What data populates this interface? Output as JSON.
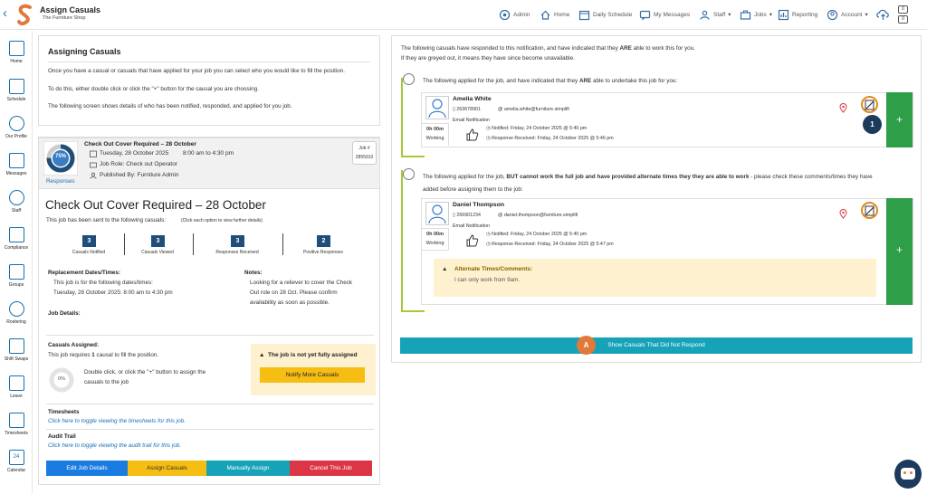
{
  "app": {
    "title": "Assign Casuals",
    "subtitle": "The Furniture Shop",
    "nav": [
      {
        "label": "Admin",
        "icon": "admin-icon"
      },
      {
        "label": "Home",
        "icon": "home-icon"
      },
      {
        "label": "Daily Schedule",
        "icon": "calendar-icon"
      },
      {
        "label": "My Messages",
        "icon": "messages-icon"
      },
      {
        "label": "Staff",
        "icon": "staff-icon"
      },
      {
        "label": "Jobs",
        "icon": "jobs-icon"
      },
      {
        "label": "Reporting",
        "icon": "reporting-icon"
      },
      {
        "label": "Account",
        "icon": "account-icon"
      }
    ],
    "badge_top": "0",
    "badge_bottom": "0"
  },
  "sidebar": {
    "items": [
      "Home",
      "Schedule",
      "Our Profile",
      "Messages",
      "Staff",
      "Compliance",
      "Groups",
      "Rostering",
      "Shift Swaps",
      "Leave",
      "Timesheets",
      "Calendar"
    ],
    "calendar_day": "24"
  },
  "intro": {
    "heading": "Assigning Casuals",
    "lines": [
      "Once you have a casual or casuals that have applied for your job you can select who you would like to fill the position.",
      "To do this, either double click or click the \"+\" button for the causal you are choosing.",
      "The following screen shows details of who has been notified, responded, and applied for you job."
    ]
  },
  "job": {
    "progress_label": "75%",
    "progress_value": 0.75,
    "responses_link": "Responses",
    "title": "Check Out Cover Required – 28 October",
    "date": "Tuesday, 28 October 2025",
    "time": "8:00 am to 4:30 pm",
    "role": "Job Role: Check out Operator",
    "published": "Published By: Furniture Admin",
    "job_number_label": "Job #",
    "job_number": "2855910",
    "big_title": "Check Out Cover Required – 28 October",
    "sent_to": "This job has been sent to the following casuals:",
    "sent_hint": "(Click each option to view further details)",
    "stats": [
      {
        "value": "3",
        "label": "Casuals Notified"
      },
      {
        "value": "3",
        "label": "Casuals Viewed"
      },
      {
        "value": "3",
        "label": "Responses Received"
      },
      {
        "value": "2",
        "label": "Positive Responses"
      }
    ],
    "replacement_heading": "Replacement Dates/Times:",
    "replacement_line1": "This job is for the following dates/times:",
    "replacement_line2": "Tuesday, 28 October 2025: 8:00 am to 4:30 pm",
    "notes_heading": "Notes:",
    "notes": [
      "Looking for a reliever to cover the Check",
      "Out role on 28 Oct. Please confirm",
      "availability as soon as possible."
    ],
    "job_details_heading": "Job Details:",
    "casuals_assigned_heading": "Casuals Assigned:",
    "requires_pre": "This job requires ",
    "requires_num": "1",
    "requires_post": " causal to fill the position.",
    "assigned_pct": "0%",
    "assign_hint": [
      "Double click, or click the \"+\" button to assign the",
      "casuals to the job"
    ],
    "warning": "The job is not yet fully assigned",
    "notify_more": "Notify More Casuals",
    "timesheets_heading": "Timesheets",
    "timesheets_link": "Click here to toggle viewing the timesheets for this job.",
    "audit_heading": "Audit Trail",
    "audit_link": "Click here to toggle viewing the audit trail for this job.",
    "buttons": {
      "edit": "Edit Job Details",
      "assign": "Assign Casuals",
      "manual": "Manually Assign",
      "cancel": "Cancel This Job"
    }
  },
  "responses": {
    "intro1_pre": "The following casuals have responded to this notification, and have indicated that they ",
    "intro1_bold": "ARE",
    "intro1_post": " able to work this for you.",
    "intro2": "If they are greyed out, it means they have since become unavailable.",
    "full_heading_pre": "The following applied for the job, and have indicated that they ",
    "full_heading_bold": "ARE",
    "full_heading_post": " able to undertake this job for you:",
    "partial_heading_pre": "The following applied for the job, ",
    "partial_heading_bold": "BUT cannot work the full job and have provided alternate times they they are able to work",
    "partial_heading_post": " - please check these comments/times they have",
    "partial_heading_line2": "added before assigning them to the job:",
    "casuals": [
      {
        "name": "Amelia White",
        "phone": "263678901",
        "email": "amelia.white@furniture.simplifi",
        "duration": "0h 00m",
        "status": "Working",
        "notification_label": "Email Notification",
        "notified": "Notified: Friday, 24 October 2025 @ 5:40 pm",
        "received": "Response Received: Friday, 24 October 2025 @ 5:46 pm"
      },
      {
        "name": "Daniel Thompson",
        "phone": "266901234",
        "email": "daniel.thompson@furniture.simplifi",
        "duration": "0h 00m",
        "status": "Working",
        "notification_label": "Email Notification",
        "notified": "Notified: Friday, 24 October 2025 @ 5:40 pm",
        "received": "Response Received: Friday, 24 October 2025 @ 5:47 pm"
      }
    ],
    "alt_heading": "Alternate Times/Comments:",
    "alt_text": "I can only work from 9am.",
    "add_symbol": "+",
    "show_not_responded": "Show Casuals That Did Not Respond"
  },
  "markers": {
    "one": "1",
    "a": "A"
  },
  "colors": {
    "primary": "#1e4e79",
    "green": "#2e9e48",
    "yellow": "#f6bd13",
    "teal": "#16a2b8",
    "blue": "#1a7ce0",
    "red": "#dc3545",
    "orange_marker": "#e07a3a",
    "navy_marker": "#1b3a5c"
  }
}
